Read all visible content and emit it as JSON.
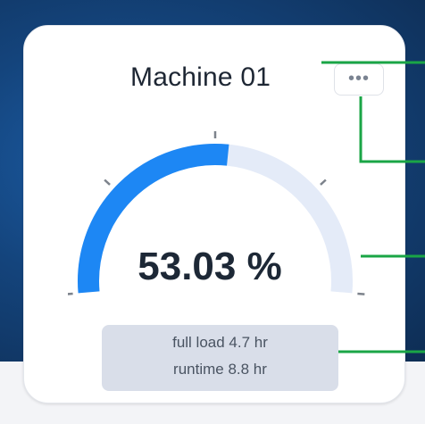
{
  "card": {
    "title": "Machine 01",
    "more_button_label": "•••"
  },
  "gauge": {
    "value_label": "53.03 %",
    "value_percent": 53.03,
    "colors": {
      "fill": "#1d87f4",
      "track": "#e4ebf8",
      "tick": "#7d838c"
    }
  },
  "stats": {
    "full_load": "full load 4.7 hr",
    "runtime": "runtime 8.8 hr"
  },
  "callout_color": "#1aa546",
  "icons": {
    "more": "ellipsis-icon"
  }
}
